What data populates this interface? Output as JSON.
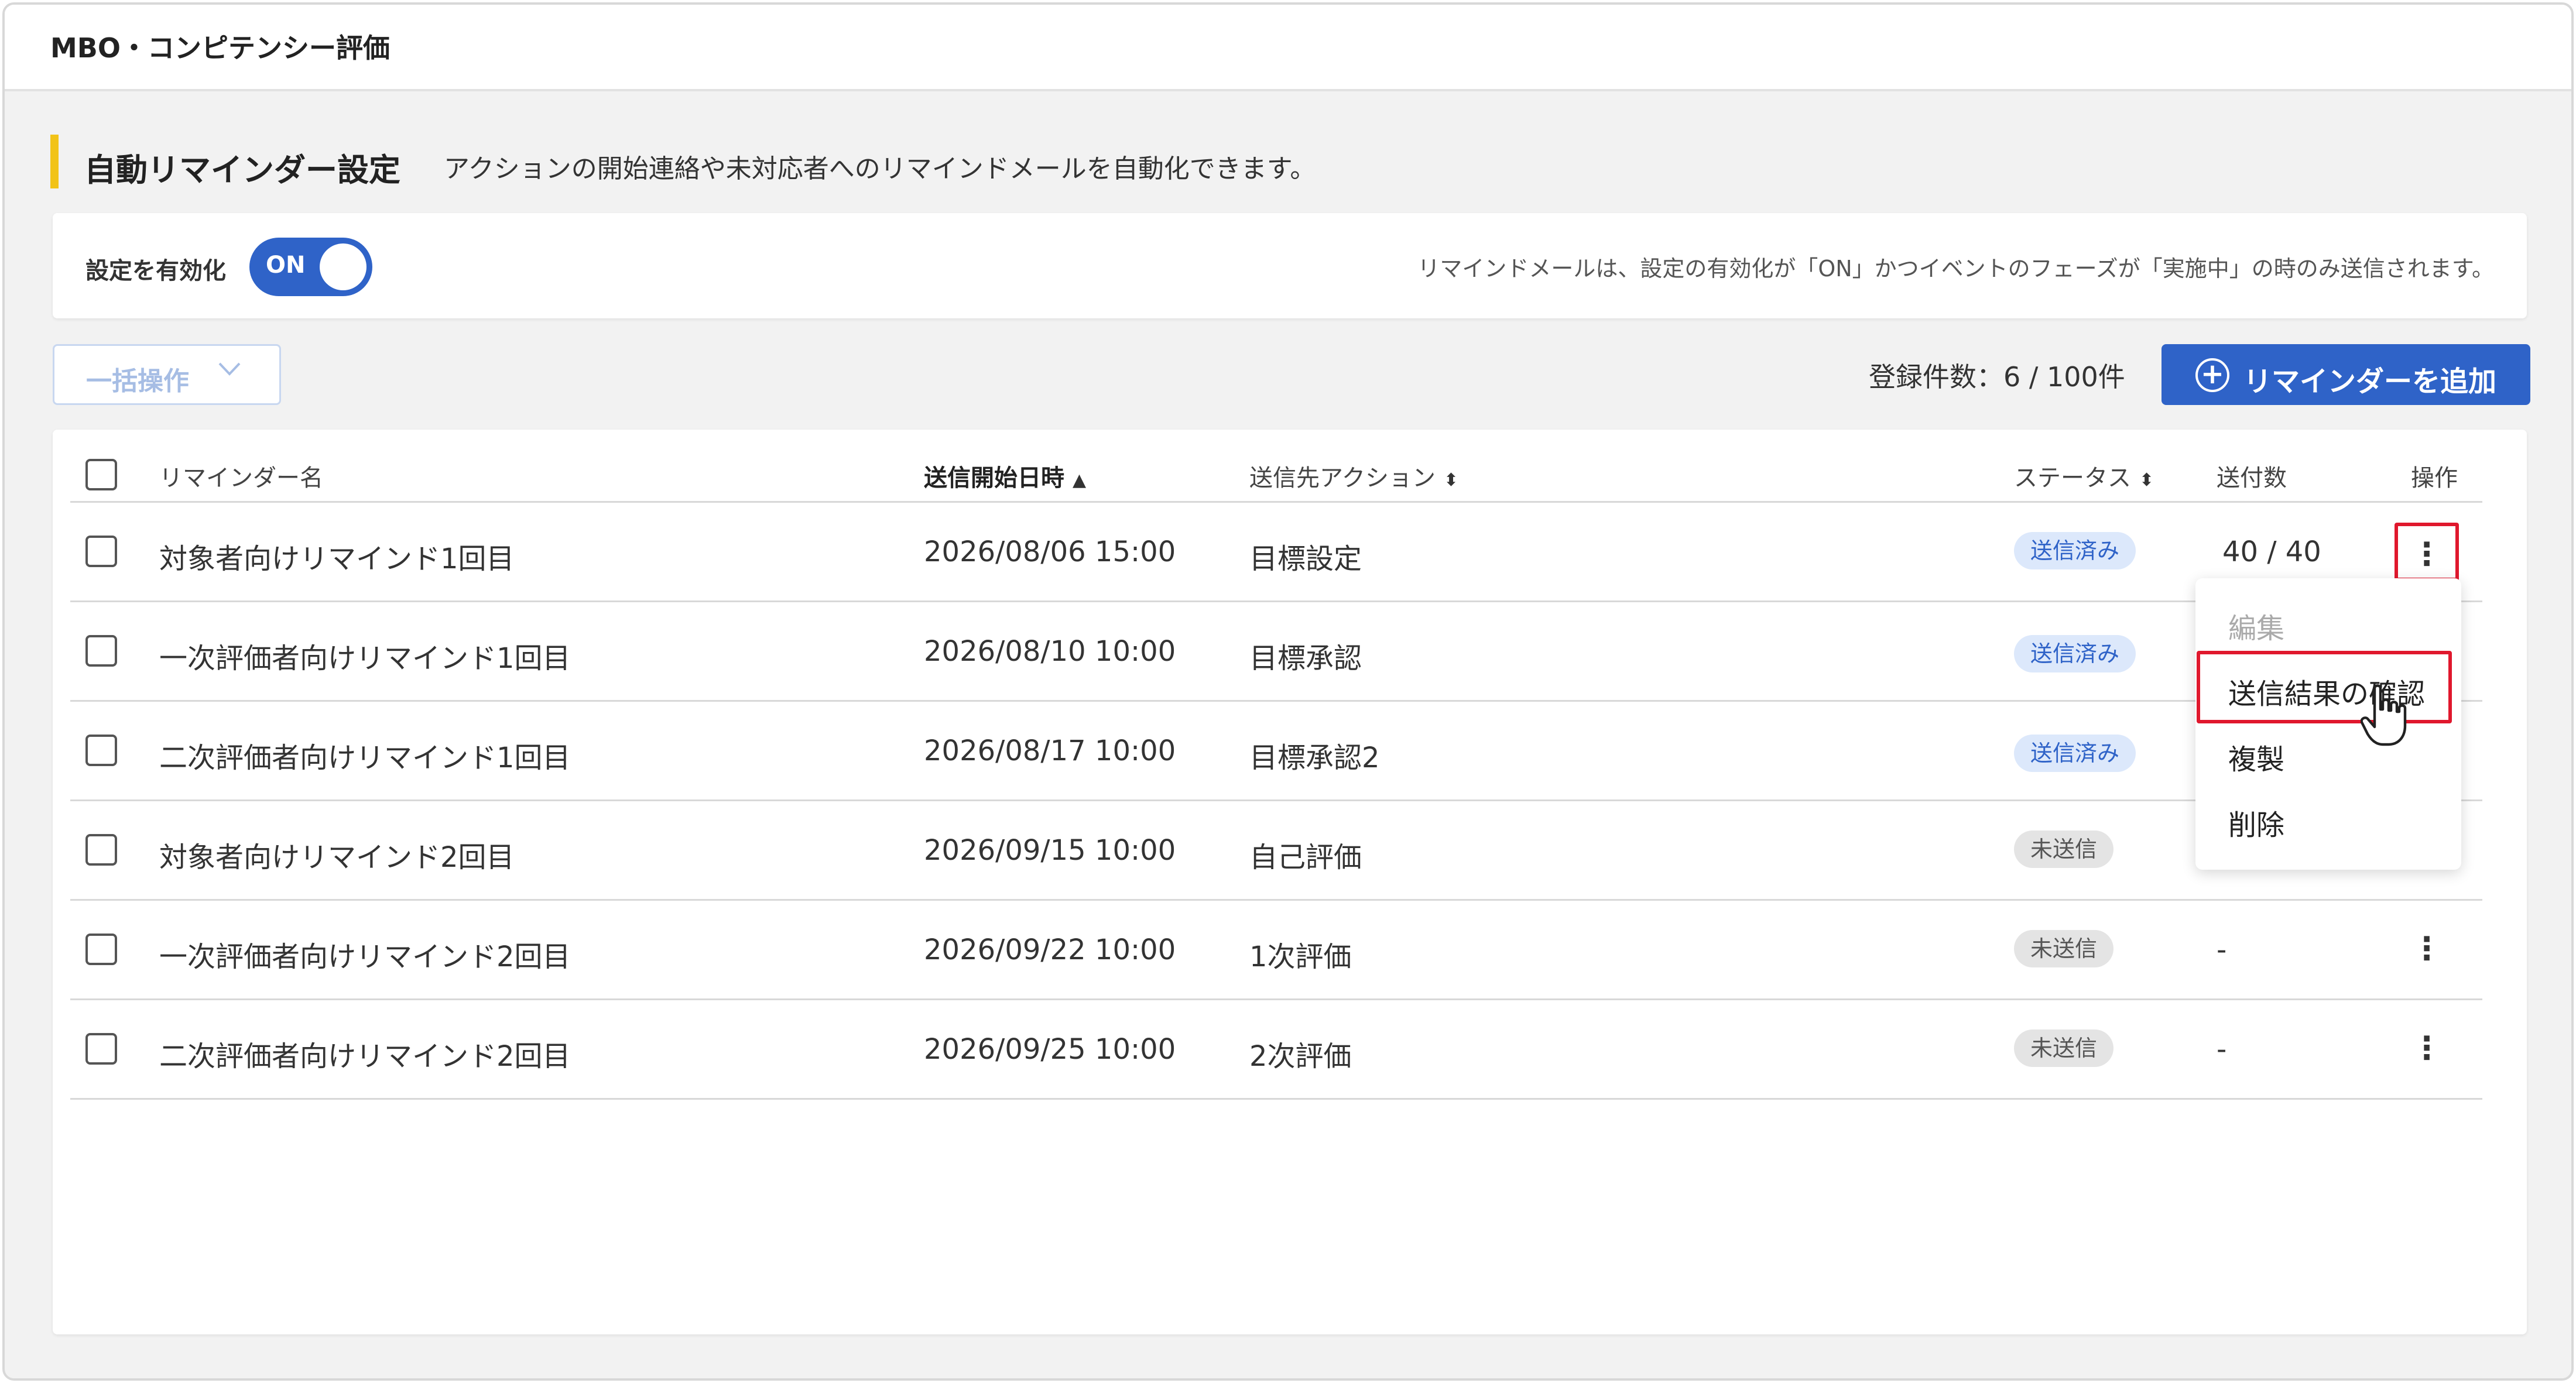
{
  "app": {
    "title": "MBO・コンピテンシー評価"
  },
  "section": {
    "title": "自動リマインダー設定",
    "description": "アクションの開始連絡や未対応者へのリマインドメールを自動化できます。"
  },
  "settings": {
    "toggle_label": "設定を有効化",
    "toggle_state": "ON",
    "note": "リマインドメールは、設定の有効化が「ON」かつイベントのフェーズが「実施中」の時のみ送信されます。"
  },
  "toolbar": {
    "bulk_label": "一括操作",
    "count_text": "登録件数：6 / 100件",
    "add_label": "リマインダーを追加"
  },
  "table": {
    "headers": {
      "name": "リマインダー名",
      "start": "送信開始日時",
      "action": "送信先アクション",
      "status": "ステータス",
      "sent": "送付数",
      "ops": "操作"
    },
    "rows": [
      {
        "name": "対象者向けリマインド1回目",
        "start": "2026/08/06 15:00",
        "action": "目標設定",
        "status": "送信済み",
        "sent": "40 / 40"
      },
      {
        "name": "一次評価者向けリマインド1回目",
        "start": "2026/08/10 10:00",
        "action": "目標承認",
        "status": "送信済み",
        "sent": ""
      },
      {
        "name": "二次評価者向けリマインド1回目",
        "start": "2026/08/17 10:00",
        "action": "目標承認2",
        "status": "送信済み",
        "sent": ""
      },
      {
        "name": "対象者向けリマインド2回目",
        "start": "2026/09/15 10:00",
        "action": "自己評価",
        "status": "未送信",
        "sent": ""
      },
      {
        "name": "一次評価者向けリマインド2回目",
        "start": "2026/09/22 10:00",
        "action": "1次評価",
        "status": "未送信",
        "sent": "-"
      },
      {
        "name": "二次評価者向けリマインド2回目",
        "start": "2026/09/25 10:00",
        "action": "2次評価",
        "status": "未送信",
        "sent": "-"
      }
    ]
  },
  "menu": {
    "items": [
      "編集",
      "送信結果の確認",
      "複製",
      "削除"
    ]
  },
  "colors": {
    "primary": "#2f63c8",
    "accent": "#f2c318",
    "highlight": "#e0182d"
  }
}
